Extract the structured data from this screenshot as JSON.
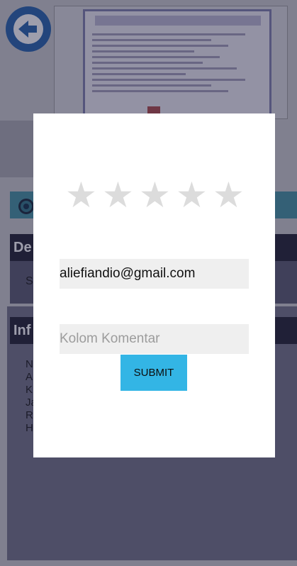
{
  "background": {
    "section_details_label": "De",
    "section_details_text": "S",
    "section_info_label": "Inf",
    "info_lines": [
      "N",
      "A",
      "K",
      "Ja",
      "R",
      "H"
    ]
  },
  "icons": {
    "back": "arrow-left-icon",
    "star": "star-icon",
    "radio": "radio-button-icon"
  },
  "rating_dialog": {
    "stars": [
      "★",
      "★",
      "★",
      "★",
      "★"
    ],
    "email_value": "aliefiandio@gmail.com",
    "comment_placeholder": "Kolom Komentar",
    "submit_label": "SUBMIT"
  },
  "colors": {
    "accent": "#33b5e5",
    "star_inactive": "#dcdcdc",
    "back_button": "#1f5ea8"
  }
}
